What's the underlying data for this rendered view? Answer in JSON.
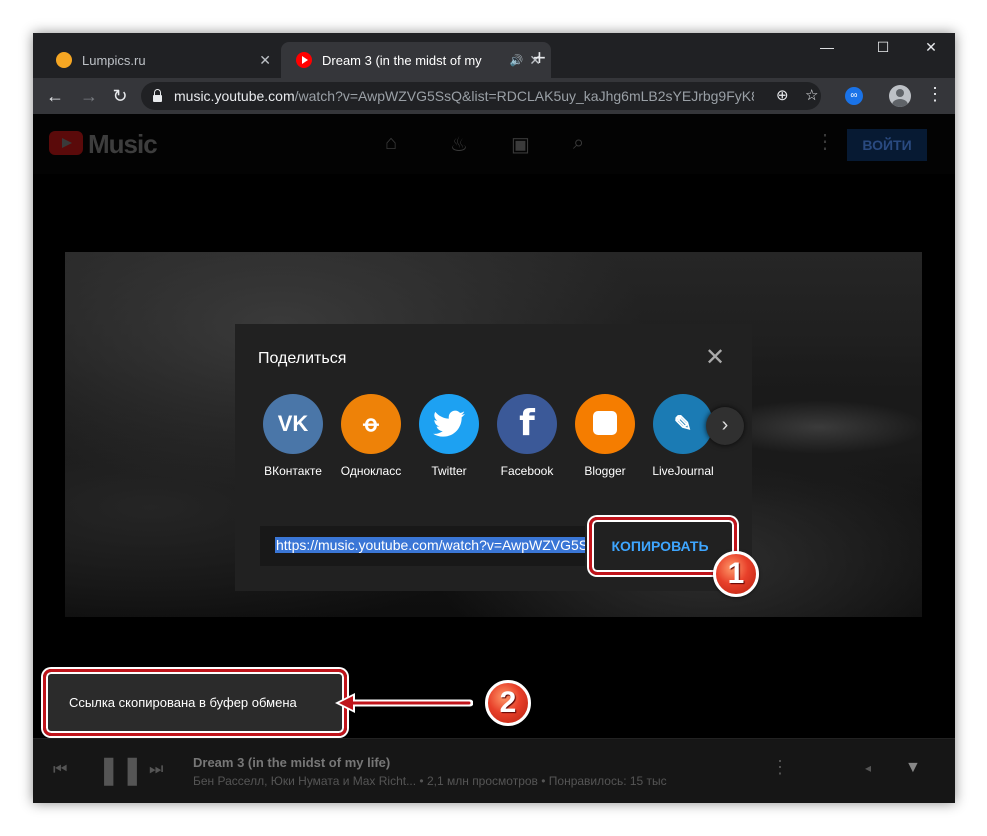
{
  "browser": {
    "tabs": [
      {
        "title": "Lumpics.ru",
        "active": false
      },
      {
        "title": "Dream 3 (in the midst of my",
        "active": true
      }
    ],
    "url_host": "music.youtube.com",
    "url_path": "/watch?v=AwpWZVG5SsQ&list=RDCLAK5uy_kaJhg6mLB2sYEJrbg9FyK8rv..."
  },
  "header": {
    "logo_text": "Music",
    "signin_label": "ВОЙТИ"
  },
  "share_dialog": {
    "title": "Поделиться",
    "targets": [
      {
        "label": "ВКонтакте",
        "glyph": "VK",
        "color": "#4a76a8"
      },
      {
        "label": "Однокласс",
        "glyph": "ok",
        "color": "#ee8208"
      },
      {
        "label": "Twitter",
        "glyph": "tw",
        "color": "#1da1f2"
      },
      {
        "label": "Facebook",
        "glyph": "f",
        "color": "#3b5998"
      },
      {
        "label": "Blogger",
        "glyph": "B",
        "color": "#f57d00"
      },
      {
        "label": "LiveJournal",
        "glyph": "LJ",
        "color": "#1b7bb4"
      }
    ],
    "url_value": "https://music.youtube.com/watch?v=AwpWZVG5S",
    "copy_label": "КОПИРОВАТЬ"
  },
  "annotations": {
    "step1": "1",
    "step2": "2",
    "highlight_color": "#c0141b"
  },
  "toast": {
    "message": "Ссылка скопирована в буфер обмена"
  },
  "player": {
    "track_title": "Dream 3 (in the midst of my life)",
    "track_meta": "Бен Расселл, Юки Нумата и Max Richt... • 2,1 млн просмотров • Понравилось: 15 тыс"
  }
}
